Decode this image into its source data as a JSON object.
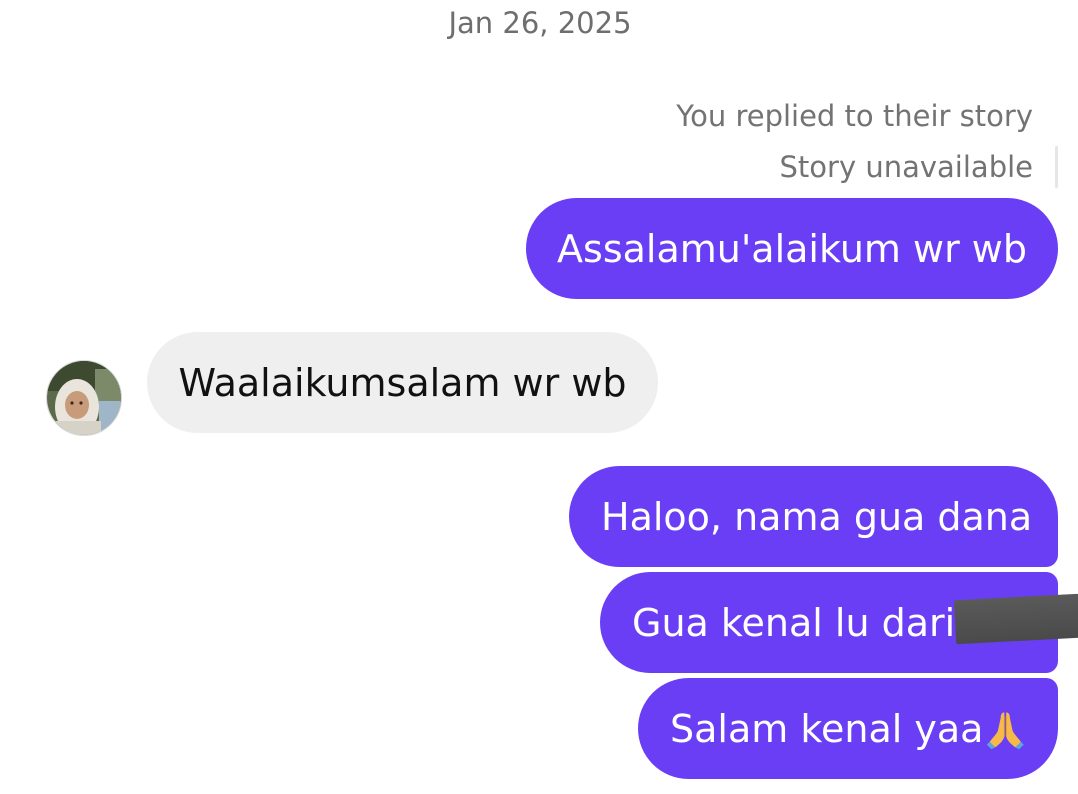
{
  "date_separator": "Jan 26, 2025",
  "story": {
    "replied_text": "You replied to their story",
    "unavailable_text": "Story unavailable"
  },
  "messages": [
    {
      "direction": "outgoing",
      "text": "Assalamu'alaikum wr wb"
    },
    {
      "direction": "incoming",
      "text": "Waalaikumsalam wr wb"
    },
    {
      "direction": "outgoing",
      "text": "Haloo, nama gua dana"
    },
    {
      "direction": "outgoing",
      "text": "Gua kenal lu dari",
      "redacted_suffix": true
    },
    {
      "direction": "outgoing",
      "text": "Salam kenal yaa",
      "emoji": "folded-hands-icon"
    }
  ],
  "colors": {
    "outgoing_bubble": "#6a3ef5",
    "incoming_bubble": "#efefef",
    "meta_text": "#737373"
  }
}
